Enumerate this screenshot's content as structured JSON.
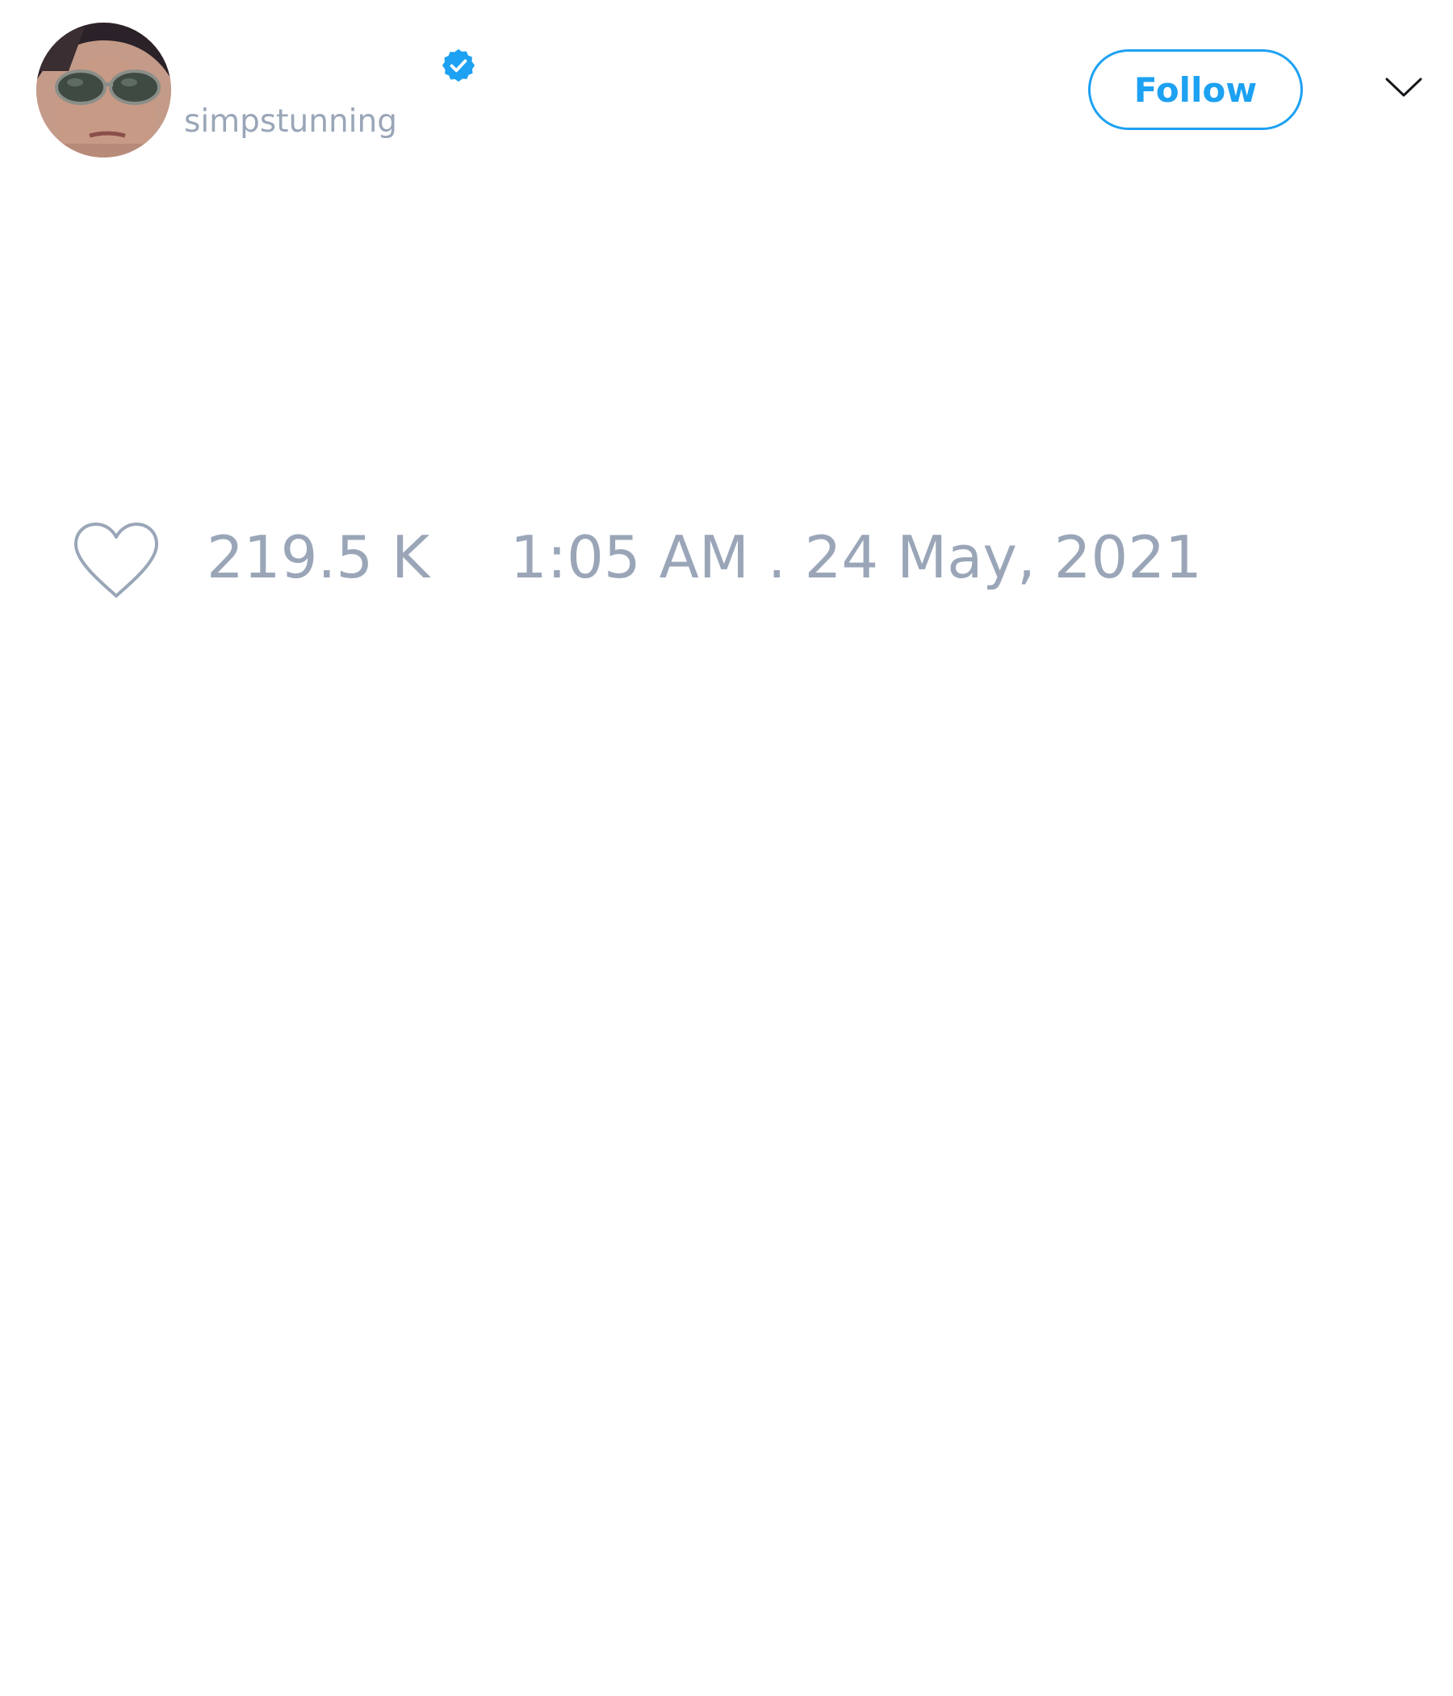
{
  "user": {
    "display_name": "",
    "handle": "simpstunning",
    "verified": true
  },
  "header": {
    "follow_label": "Follow",
    "menu_icon": "chevron-down-icon"
  },
  "stats": {
    "like_icon": "heart-icon",
    "like_count": "219.5 K",
    "timestamp": "1:05 AM . 24 May, 2021"
  },
  "colors": {
    "accent": "#1da1f2",
    "muted_text": "#9aa6b8",
    "background": "#ffffff"
  }
}
